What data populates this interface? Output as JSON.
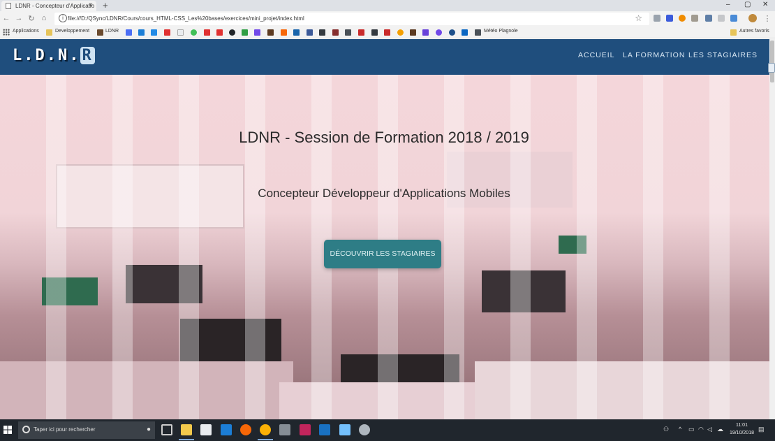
{
  "browser": {
    "tab_title": "LDNR - Concepteur d'Applicatio",
    "tab_close": "×",
    "new_tab": "+",
    "window_controls": [
      "–",
      "▢",
      "✕"
    ],
    "nav": {
      "back": "←",
      "forward": "→",
      "reload": "↻",
      "home": "⌂"
    },
    "url": "file:///D:/QSync/LDNR/Cours/cours_HTML-CSS_Les%20bases/exercices/mini_projet/index.html",
    "bookmark_star": "☆",
    "bookmarks": {
      "apps": "Applications",
      "developpement": "Developpement",
      "ldnr": "LDNR",
      "meteo": "Météo Plagnole",
      "others": "Autres favoris"
    }
  },
  "site": {
    "logo": "L.D.N.",
    "logo_r": "R",
    "menu": [
      "ACCUEIL",
      "LA FORMATION",
      "LES STAGIAIRES"
    ],
    "hero_title": "LDNR - Session de Formation 2018 / 2019",
    "hero_subtitle": "Concepteur Développeur d'Applications Mobiles",
    "cta_label": "DÉCOUVRIR LES STAGIAIRES"
  },
  "taskbar": {
    "search_placeholder": "Taper ici pour rechercher",
    "mic": "🎤",
    "time": "11:01",
    "date": "19/10/2018"
  },
  "colors": {
    "navbar": "#1f4e7d",
    "cta": "#2e7d86",
    "taskbar": "#20262d"
  }
}
